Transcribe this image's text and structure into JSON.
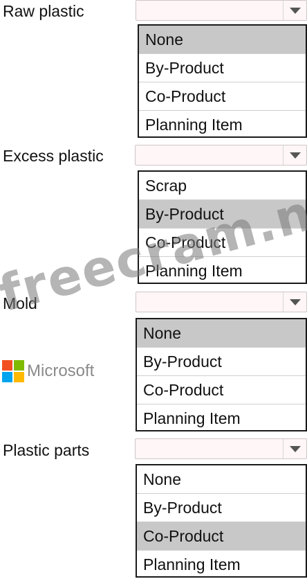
{
  "fields": [
    {
      "label": "Raw plastic",
      "options": [
        "None",
        "By-Product",
        "Co-Product",
        "Planning Item"
      ],
      "selected_index": 0
    },
    {
      "label": "Excess plastic",
      "options": [
        "Scrap",
        "By-Product",
        "Co-Product",
        "Planning Item"
      ],
      "selected_index": 1
    },
    {
      "label": "Mold",
      "options": [
        "None",
        "By-Product",
        "Co-Product",
        "Planning Item"
      ],
      "selected_index": 0
    },
    {
      "label": "Plastic parts",
      "options": [
        "None",
        "By-Product",
        "Co-Product",
        "Planning Item"
      ],
      "selected_index": 2
    }
  ],
  "watermark": "freecram.net",
  "logo": {
    "text": "Microsoft",
    "colors": [
      "#f25022",
      "#7fba00",
      "#00a4ef",
      "#ffb900"
    ]
  },
  "theme": {
    "combo_bg": "#fff6f7",
    "selected_bg": "#c8c8c8",
    "list_border": "#1a1a1a"
  }
}
